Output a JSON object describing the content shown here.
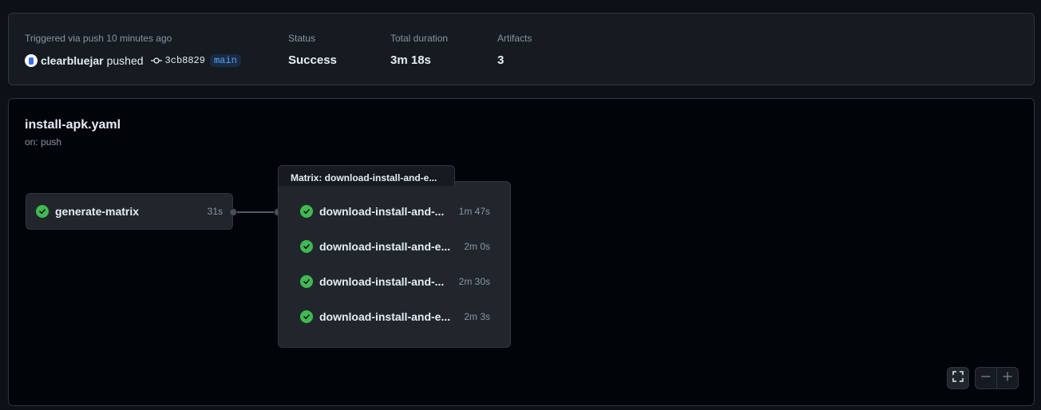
{
  "summary": {
    "trigger_text": "Triggered via push 10 minutes ago",
    "actor": "clearbluejar",
    "action": "pushed",
    "commit_sha": "3cb8829",
    "branch": "main",
    "status_label": "Status",
    "status_value": "Success",
    "duration_label": "Total duration",
    "duration_value": "3m 18s",
    "artifacts_label": "Artifacts",
    "artifacts_value": "3"
  },
  "workflow": {
    "name": "install-apk.yaml",
    "trigger": "on: push"
  },
  "jobs": [
    {
      "name": "generate-matrix",
      "duration": "31s",
      "status": "success"
    }
  ],
  "matrix": {
    "title": "Matrix: download-install-and-e...",
    "jobs": [
      {
        "name": "download-install-and-...",
        "duration": "1m 47s",
        "status": "success"
      },
      {
        "name": "download-install-and-e...",
        "duration": "2m 0s",
        "status": "success"
      },
      {
        "name": "download-install-and-...",
        "duration": "2m 30s",
        "status": "success"
      },
      {
        "name": "download-install-and-e...",
        "duration": "2m 3s",
        "status": "success"
      }
    ]
  },
  "icons": {
    "check": "check-circle-icon",
    "commit": "git-commit-icon",
    "fullscreen": "fullscreen-icon",
    "zoom_out": "minus-icon",
    "zoom_in": "plus-icon"
  },
  "colors": {
    "success": "#3fb950",
    "branch": "#58a6ff"
  }
}
